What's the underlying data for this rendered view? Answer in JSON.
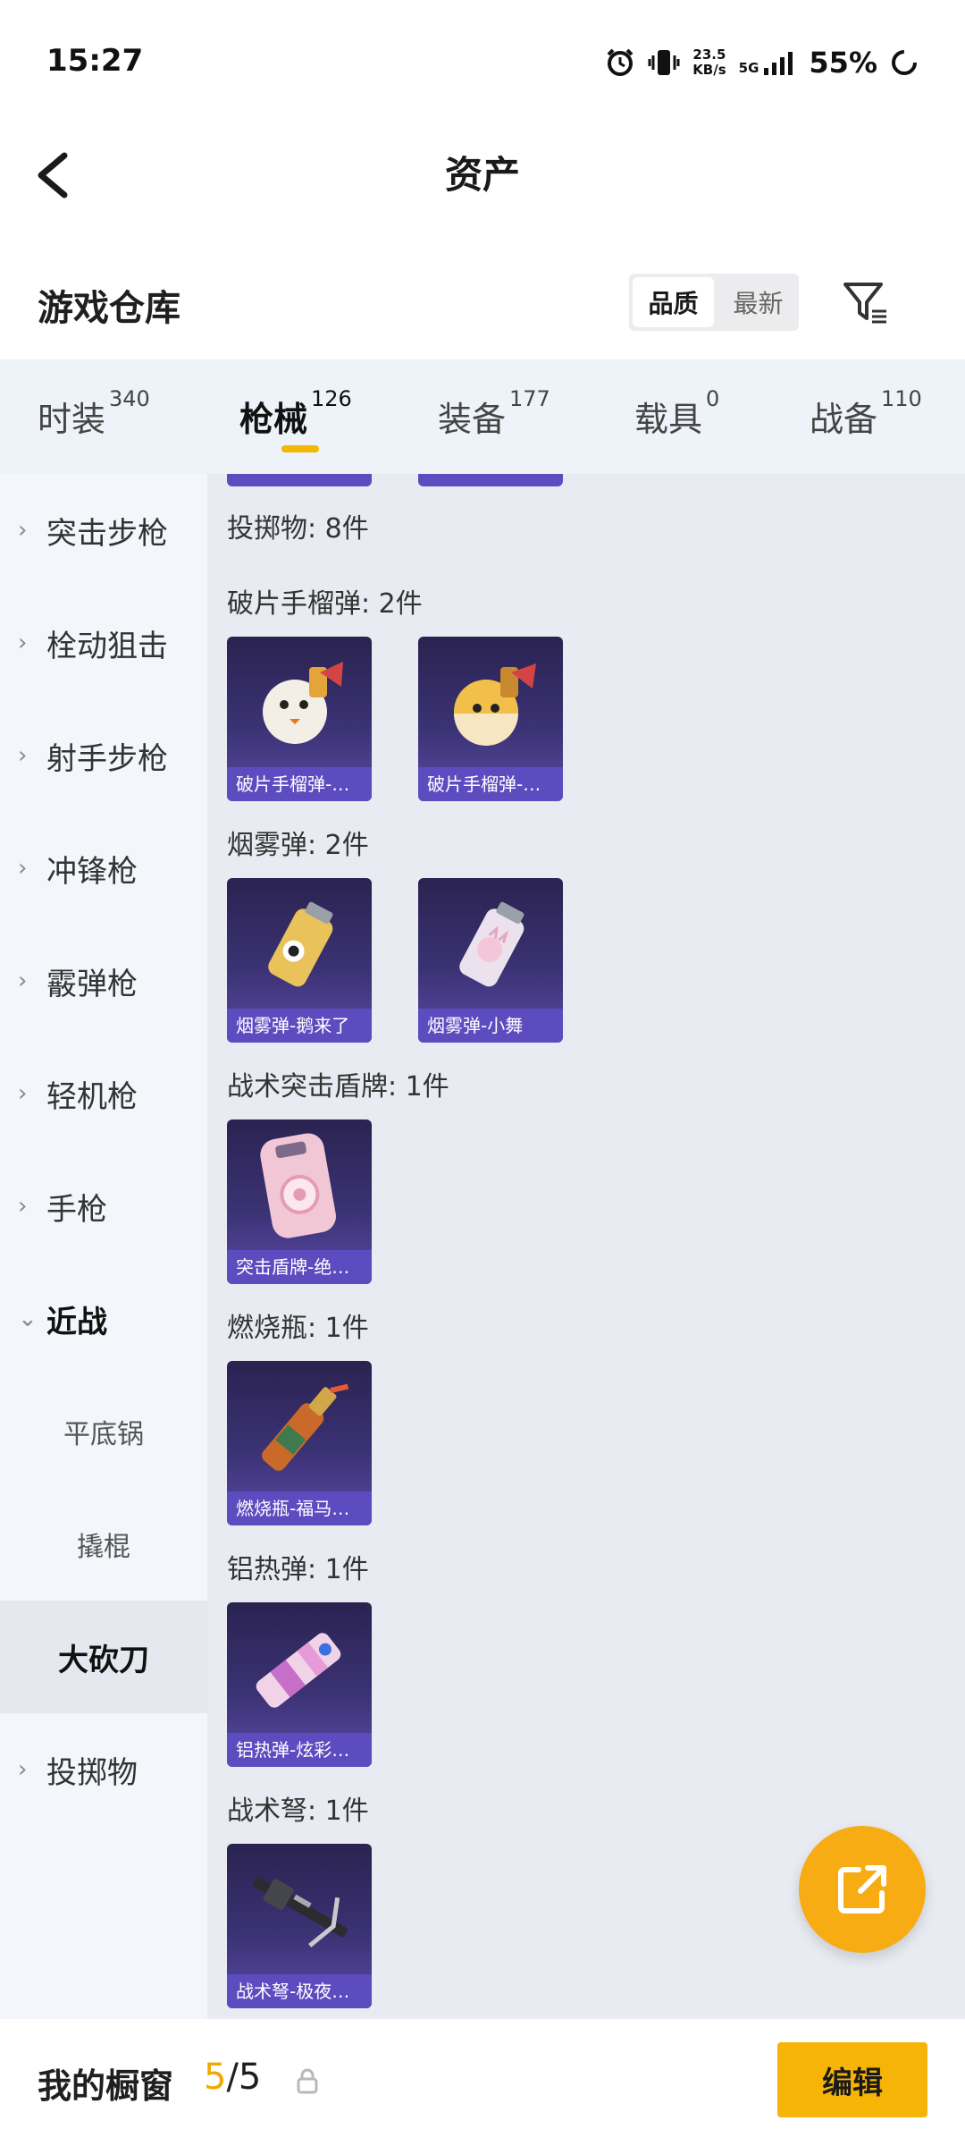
{
  "status_bar": {
    "time": "15:27",
    "speed_value": "23.5",
    "speed_unit": "KB/s",
    "network": "5G",
    "battery": "55%"
  },
  "header": {
    "title": "资产"
  },
  "warehouse": {
    "title": "游戏仓库",
    "sort_options": [
      "品质",
      "最新"
    ],
    "sort_selected": "品质"
  },
  "tabs": [
    {
      "label": "时装",
      "count": "340"
    },
    {
      "label": "枪械",
      "count": "126",
      "active": true
    },
    {
      "label": "装备",
      "count": "177"
    },
    {
      "label": "载具",
      "count": "0"
    },
    {
      "label": "战备",
      "count": "110"
    }
  ],
  "sidebar": {
    "items": [
      {
        "label": "突击步枪"
      },
      {
        "label": "栓动狙击"
      },
      {
        "label": "射手步枪"
      },
      {
        "label": "冲锋枪"
      },
      {
        "label": "霰弹枪"
      },
      {
        "label": "轻机枪"
      },
      {
        "label": "手枪"
      },
      {
        "label": "近战",
        "expanded": true
      },
      {
        "label": "投掷物"
      }
    ],
    "subitems": [
      {
        "label": "平底锅"
      },
      {
        "label": "撬棍"
      },
      {
        "label": "大砍刀",
        "selected": true
      }
    ]
  },
  "content": {
    "section_header": "投掷物: 8件",
    "groups": [
      {
        "label": "破片手榴弹: 2件",
        "items": [
          "破片手榴弹-…",
          "破片手榴弹-…"
        ]
      },
      {
        "label": "烟雾弹: 2件",
        "items": [
          "烟雾弹-鹅来了",
          "烟雾弹-小舞"
        ]
      },
      {
        "label": "战术突击盾牌: 1件",
        "items": [
          "突击盾牌-绝…"
        ]
      },
      {
        "label": "燃烧瓶: 1件",
        "items": [
          "燃烧瓶-福马…"
        ]
      },
      {
        "label": "铝热弹: 1件",
        "items": [
          "铝热弹-炫彩…"
        ]
      },
      {
        "label": "战术弩: 1件",
        "items": [
          "战术弩-极夜…"
        ]
      }
    ]
  },
  "bottom_bar": {
    "label": "我的橱窗",
    "count_current": "5",
    "count_sep_total": "/5",
    "edit_label": "编辑"
  },
  "colors": {
    "accent": "#f6b406",
    "card_caption": "#5d4bc0",
    "tabs_bg": "#eef3fa",
    "content_bg": "#e8ecf2"
  },
  "icons": [
    "back-arrow-icon",
    "alarm-icon",
    "vibrate-icon",
    "signal-icon",
    "loading-icon",
    "filter-icon",
    "chevron-right-icon",
    "chevron-down-icon",
    "share-out-icon",
    "lock-icon"
  ]
}
